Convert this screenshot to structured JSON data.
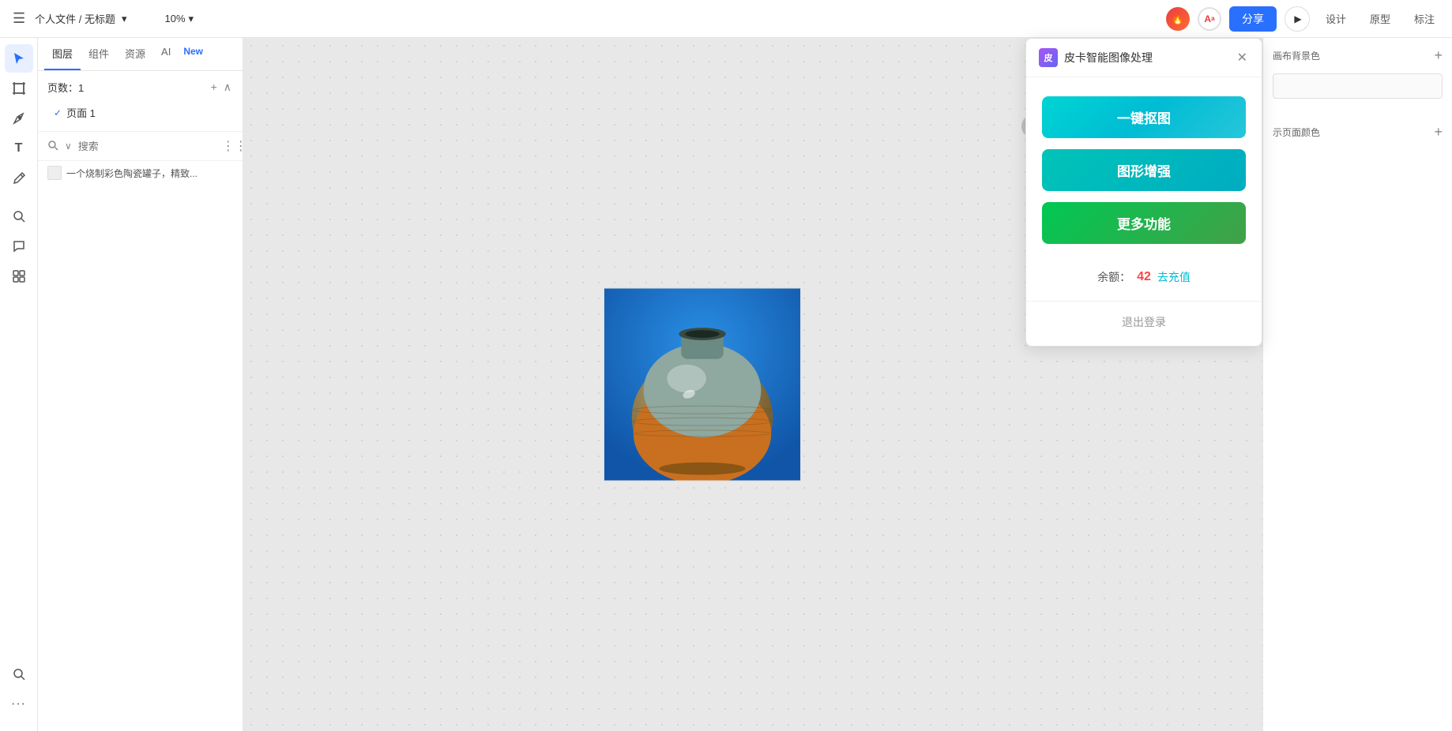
{
  "topbar": {
    "menu_icon": "☰",
    "breadcrumb": "个人文件 / 无标题",
    "breadcrumb_arrow": "▾",
    "zoom_level": "10%",
    "zoom_arrow": "▾",
    "share_label": "分享",
    "play_icon": "▶",
    "design_tab": "设计",
    "prototype_tab": "原型",
    "mark_tab": "标注"
  },
  "left_panel": {
    "tabs": [
      {
        "id": "layers",
        "label": "图层"
      },
      {
        "id": "components",
        "label": "组件"
      },
      {
        "id": "assets",
        "label": "资源"
      },
      {
        "id": "ai",
        "label": "AI"
      },
      {
        "id": "new",
        "label": "New"
      }
    ],
    "pages_title": "页数：1",
    "add_page_icon": "+",
    "collapse_icon": "∧",
    "page_item": "页面 1",
    "search_placeholder": "搜索",
    "expand_icon": "∨",
    "more_icon": "⋮",
    "layer_item_text": "一个烧制彩色陶瓷罐子，精致..."
  },
  "right_panel": {
    "canvas_bg_label": "画布背景色",
    "show_page_color_label": "示页面颜色",
    "add_icon": "+",
    "add_icon2": "+"
  },
  "plugin": {
    "title": "皮卡智能图像处理",
    "close_icon": "✕",
    "btn_cutout": "一键抠图",
    "btn_enhance": "图形增强",
    "btn_more": "更多功能",
    "balance_label": "余额：",
    "balance_value": "42",
    "recharge_label": "去充值",
    "logout_label": "退出登录"
  },
  "canvas": {
    "background": "#e8e8e8"
  },
  "colors": {
    "accent": "#2970ff",
    "cutout_btn": "#00bcd4",
    "enhance_btn": "#00acc1",
    "more_btn": "#4caf50",
    "balance_color": "#ff4444",
    "recharge_color": "#00bcd4"
  }
}
